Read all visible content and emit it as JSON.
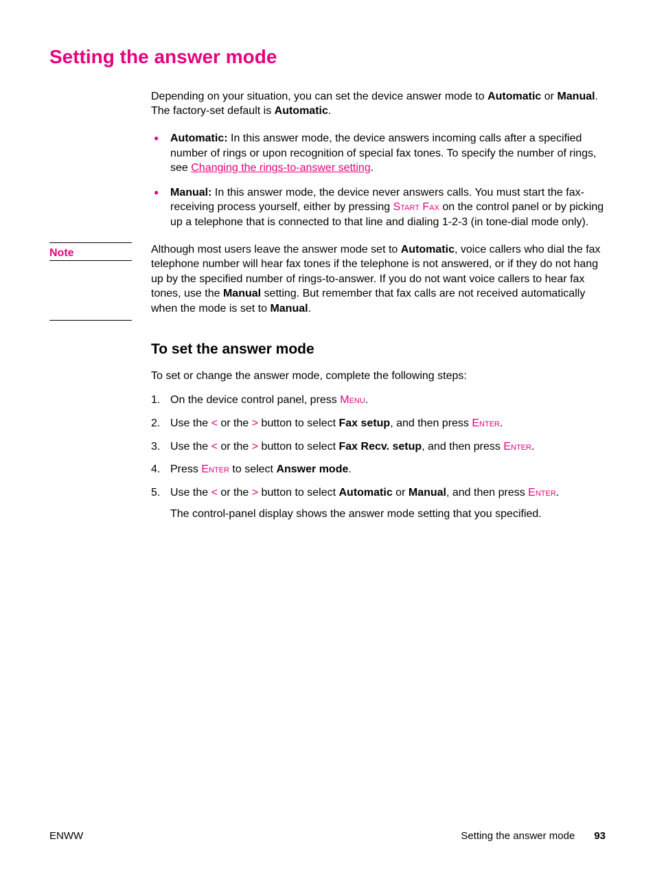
{
  "title": "Setting the answer mode",
  "intro": {
    "line1_pre": "Depending on your situation, you can set the device answer mode to ",
    "line1_b1": "Automatic",
    "line1_mid": " or ",
    "line1_b2": "Manual",
    "line1_post": ".",
    "line2_pre": "The factory-set default is ",
    "line2_b": "Automatic",
    "line2_post": "."
  },
  "bullets": {
    "auto": {
      "label": "Automatic:",
      "text": " In this answer mode, the device answers incoming calls after a specified number of rings or upon recognition of special fax tones. To specify the number of rings, see ",
      "link": "Changing the rings-to-answer setting",
      "post": "."
    },
    "manual": {
      "label": "Manual:",
      "t1": " In this answer mode, the device never answers calls. You must start the fax-receiving process yourself, either by pressing ",
      "sc1": "Start Fax",
      "t2": " on the control panel or by picking up a telephone that is connected to that line and dialing 1-2-3 (in tone-dial mode only)."
    }
  },
  "note": {
    "label": "Note",
    "t1": "Although most users leave the answer mode set to ",
    "b1": "Automatic",
    "t2": ", voice callers who dial the fax telephone number will hear fax tones if the telephone is not answered, or if they do not hang up by the specified number of rings-to-answer. If you do not want voice callers to hear fax tones, use the ",
    "b2": "Manual",
    "t3": " setting. But remember that fax calls are not received automatically when the mode is set to ",
    "b3": "Manual",
    "t4": "."
  },
  "sub": {
    "heading": "To set the answer mode",
    "intro": "To set or change the answer mode, complete the following steps:",
    "steps": {
      "s1": {
        "t1": "On the device control panel, press ",
        "sc": "Menu",
        "t2": "."
      },
      "s2": {
        "t1": "Use the ",
        "lt": "<",
        "t2": " or the ",
        "gt": ">",
        "t3": " button to select ",
        "b": "Fax setup",
        "t4": ", and then press ",
        "sc": "Enter",
        "t5": "."
      },
      "s3": {
        "t1": "Use the ",
        "lt": "<",
        "t2": " or the ",
        "gt": ">",
        "t3": " button to select ",
        "b": "Fax Recv. setup",
        "t4": ", and then press ",
        "sc": "Enter",
        "t5": "."
      },
      "s4": {
        "t1": "Press ",
        "sc": "Enter",
        "t2": " to select ",
        "b": "Answer mode",
        "t3": "."
      },
      "s5": {
        "t1": "Use the ",
        "lt": "<",
        "t2": " or the ",
        "gt": ">",
        "t3": " button to select ",
        "b1": "Automatic",
        "t4": " or ",
        "b2": "Manual",
        "t5": ", and then press ",
        "sc": "Enter",
        "t6": ".",
        "follow": "The control-panel display shows the answer mode setting that you specified."
      }
    }
  },
  "footer": {
    "left": "ENWW",
    "right_text": "Setting the answer mode",
    "page": "93"
  }
}
